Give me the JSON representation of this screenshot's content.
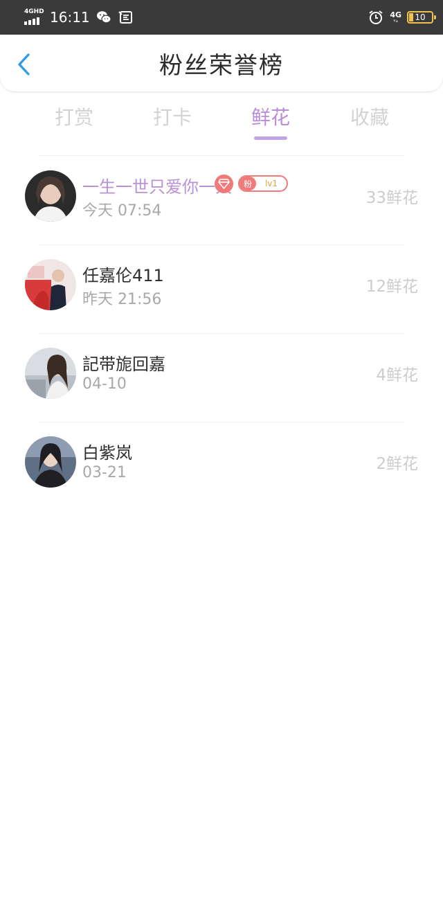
{
  "status_bar": {
    "network_label": "4GHD",
    "time": "16:11",
    "signal_label": "4G",
    "battery_level": "10",
    "icons": [
      "wechat-icon",
      "sms-icon",
      "alarm-icon"
    ]
  },
  "header": {
    "title": "粉丝荣誉榜",
    "back_icon": "chevron-left-icon"
  },
  "tabs": [
    {
      "label": "打赏",
      "active": false
    },
    {
      "label": "打卡",
      "active": false
    },
    {
      "label": "鲜花",
      "active": true
    },
    {
      "label": "收藏",
      "active": false
    }
  ],
  "colors": {
    "accent": "#b98bd9",
    "badge_red": "#f07a7a",
    "status_bar_bg": "#3a3a3a"
  },
  "fans": [
    {
      "name": "一生一世只爱你一人",
      "date": "今天 07:54",
      "amount": "33鲜花",
      "highlighted": true,
      "badge": {
        "fan_label": "粉",
        "level": "lv1"
      }
    },
    {
      "name": "任嘉伦411",
      "date": "昨天 21:56",
      "amount": "12鲜花"
    },
    {
      "name": "記带旎回嘉",
      "date": "04-10",
      "amount": "4鲜花"
    },
    {
      "name": "白紫岚",
      "date": "03-21",
      "amount": "2鲜花"
    }
  ]
}
